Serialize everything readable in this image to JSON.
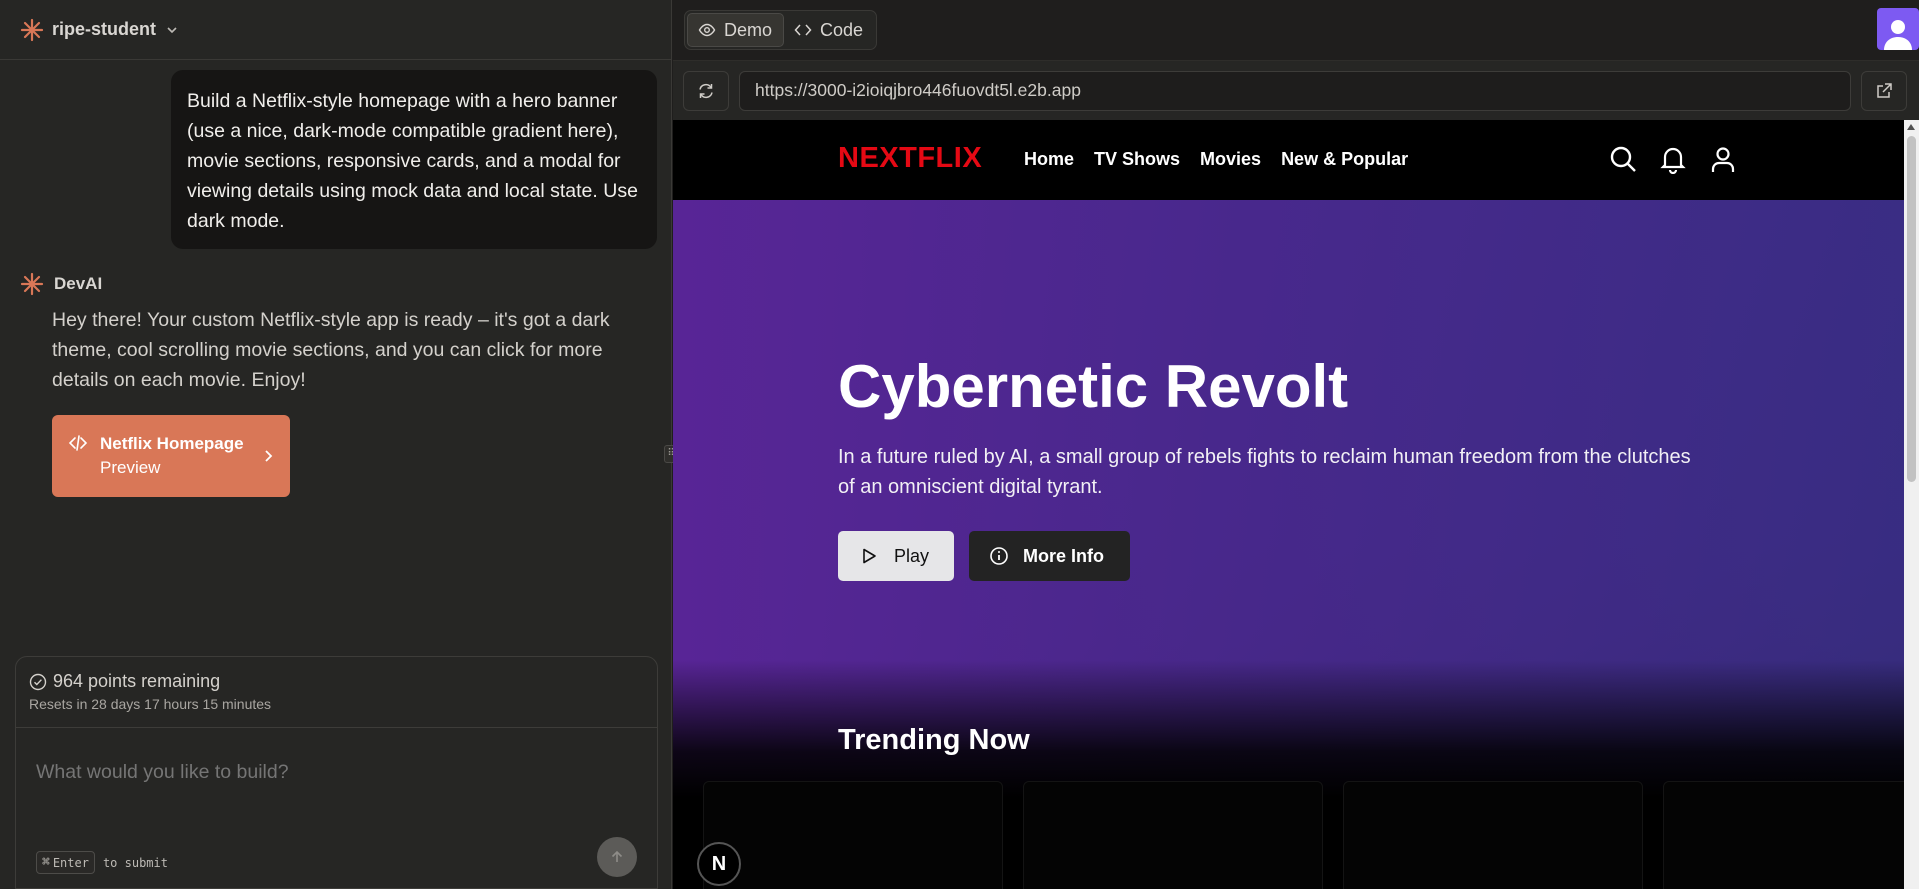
{
  "project": {
    "name": "ripe-student"
  },
  "chat": {
    "user_message": "Build a Netflix-style homepage with a hero banner (use a nice, dark-mode compatible gradient here), movie sections, responsive cards, and a modal for viewing details using mock data and local state. Use dark mode.",
    "assistant_name": "DevAI",
    "assistant_message": "Hey there! Your custom Netflix-style app is ready – it's got a dark theme, cool scrolling movie sections, and you can click for more details on each movie. Enjoy!",
    "artifact": {
      "title": "Netflix Homepage",
      "subtitle": "Preview"
    }
  },
  "composer": {
    "points": "964 points remaining",
    "resets": "Resets in 28 days 17 hours 15 minutes",
    "placeholder": "What would you like to build?",
    "kbd": "Enter",
    "submit_hint": "to submit"
  },
  "preview": {
    "tabs": [
      "Demo",
      "Code"
    ],
    "url": "https://3000-i2ioiqjbro446fuovdt5l.e2b.app"
  },
  "app": {
    "logo": "NEXTFLIX",
    "nav": [
      "Home",
      "TV Shows",
      "Movies",
      "New & Popular"
    ],
    "hero": {
      "title": "Cybernetic Revolt",
      "description": "In a future ruled by AI, a small group of rebels fights to reclaim human freedom from the clutches of an omniscient digital tyrant.",
      "play": "Play",
      "more_info": "More Info"
    },
    "section_title": "Trending Now",
    "badge": "N"
  },
  "colors": {
    "accent": "#d97757",
    "logo_red": "#e50914",
    "avatar": "#7d5af2"
  }
}
